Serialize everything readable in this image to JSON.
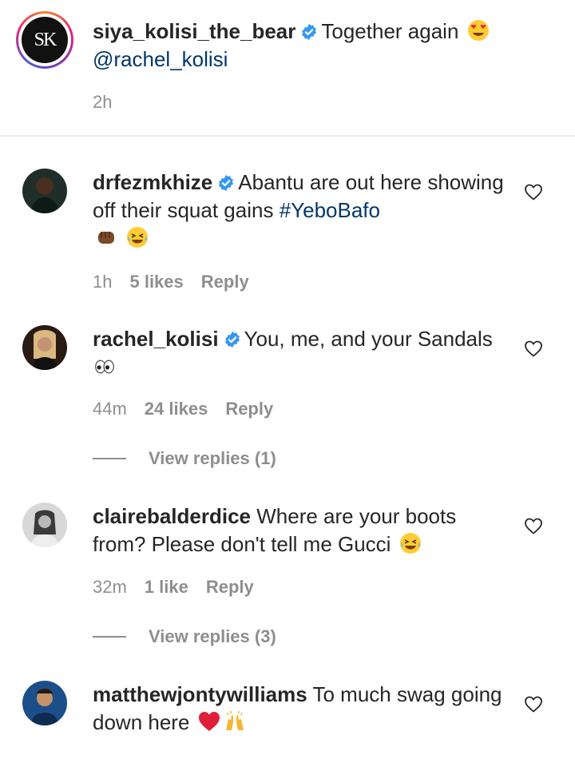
{
  "caption": {
    "username": "siya_kolisi_the_bear",
    "avatar_initials": "SK",
    "text": "Together again",
    "mention": "@rachel_kolisi",
    "time": "2h",
    "emoji": "heart-eyes"
  },
  "comments": [
    {
      "username": "drfezmkhize",
      "verified": true,
      "text": "Abantu are out here showing off their squat gains",
      "hashtag": "#YeboBafo",
      "time": "1h",
      "likes": "5 likes",
      "reply_label": "Reply"
    },
    {
      "username": "rachel_kolisi",
      "verified": true,
      "text": "You, me, and your Sandals",
      "time": "44m",
      "likes": "24 likes",
      "reply_label": "Reply",
      "view_replies": "View replies (1)"
    },
    {
      "username": "clairebalderdice",
      "verified": false,
      "text": "Where are your boots from? Please don't tell me Gucci",
      "time": "32m",
      "likes": "1 like",
      "reply_label": "Reply",
      "view_replies": "View replies (3)"
    },
    {
      "username": "matthewjontywilliams",
      "verified": false,
      "text": "To much swag going down here"
    }
  ],
  "colors": {
    "text": "#262626",
    "muted": "#8e8e8e",
    "link": "#00376b",
    "verified": "#3897f0"
  }
}
